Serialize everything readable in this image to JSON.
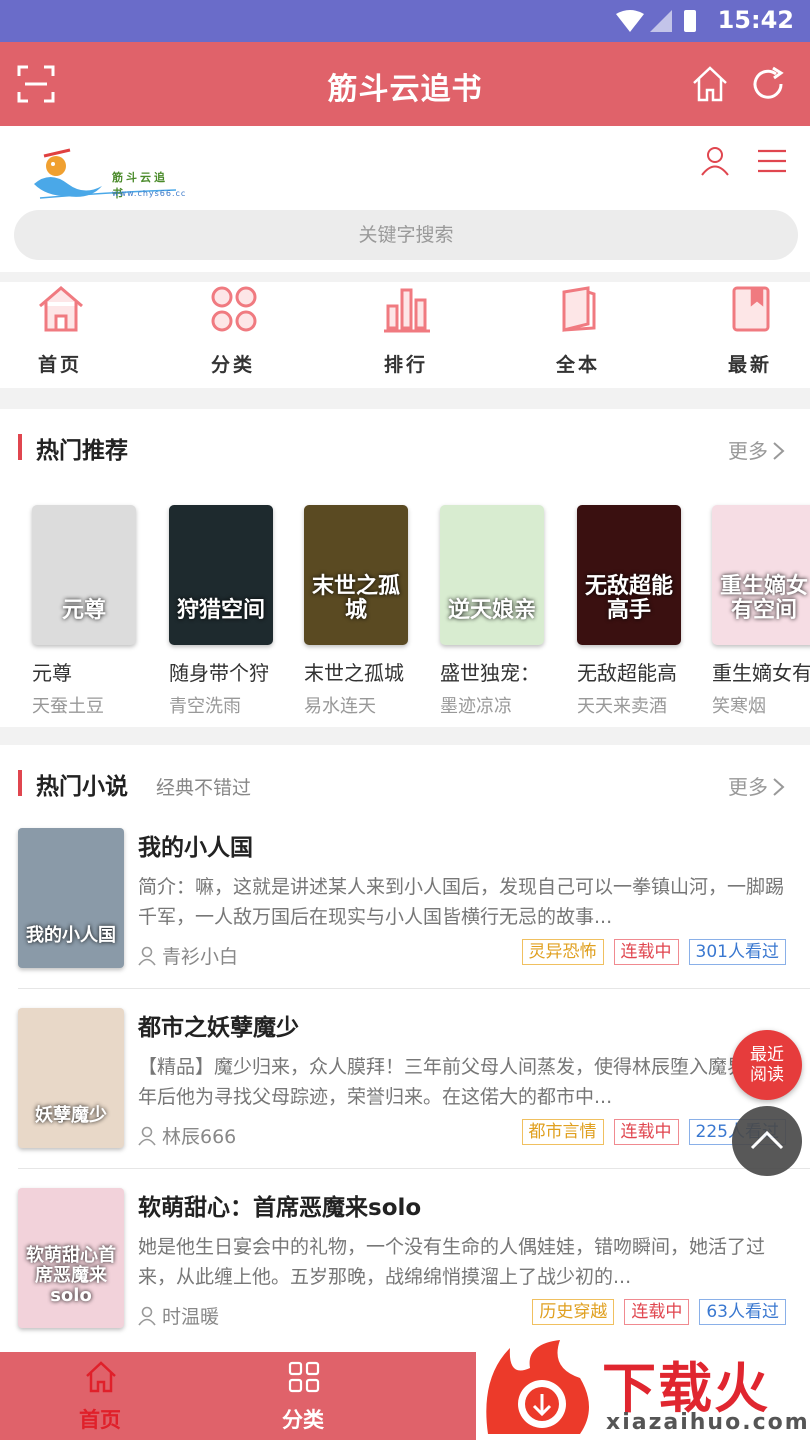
{
  "status_bar": {
    "time": "15:42"
  },
  "app_bar": {
    "title": "筋斗云追书"
  },
  "site_header": {
    "logo_text": "筋斗云追书",
    "logo_url": "www.chys66.cc",
    "search_placeholder": "关键字搜索"
  },
  "nav": [
    {
      "label": "首页",
      "icon": "home-icon"
    },
    {
      "label": "分类",
      "icon": "category-icon"
    },
    {
      "label": "排行",
      "icon": "ranking-icon"
    },
    {
      "label": "全本",
      "icon": "complete-icon"
    },
    {
      "label": "最新",
      "icon": "latest-icon"
    }
  ],
  "hot_recommend": {
    "title": "热门推荐",
    "more": "更多",
    "books": [
      {
        "title": "元尊",
        "author": "天蚕土豆",
        "cover_text": "元尊",
        "cover_color": "#dcdcdc"
      },
      {
        "title": "随身带个狩",
        "author": "青空洗雨",
        "cover_text": "狩猎空间",
        "cover_color": "#1e2a2e"
      },
      {
        "title": "末世之孤城",
        "author": "易水连天",
        "cover_text": "末世之孤城",
        "cover_color": "#5a4a22"
      },
      {
        "title": "盛世独宠：",
        "author": "墨迹凉凉",
        "cover_text": "逆天娘亲",
        "cover_color": "#d8ecd0"
      },
      {
        "title": "无敌超能高",
        "author": "天天来卖酒",
        "cover_text": "无敌超能高手",
        "cover_color": "#3a1010"
      },
      {
        "title": "重生嫡女有",
        "author": "笑寒烟",
        "cover_text": "重生嫡女有空间",
        "cover_color": "#f6dde4"
      }
    ]
  },
  "hot_novels": {
    "title": "热门小说",
    "subtitle": "经典不错过",
    "more": "更多",
    "items": [
      {
        "title": "我的小人国",
        "desc": "简介：嘛，这就是讲述某人来到小人国后，发现自己可以一拳镇山河，一脚踢千军，一人敌万国后在现实与小人国皆横行无忌的故事...",
        "author": "青衫小白",
        "category": "灵异恐怖",
        "status": "连载中",
        "views": "301人看过",
        "cover_text": "我的小人国",
        "cover_color": "#8a9aa8"
      },
      {
        "title": "都市之妖孽魔少",
        "desc": "【精品】魔少归来，众人膜拜！三年前父母人间蒸发，使得林辰堕入魔界，三年后他为寻找父母踪迹，荣誉归来。在这偌大的都市中...",
        "author": "林辰666",
        "category": "都市言情",
        "status": "连载中",
        "views": "225人看过",
        "cover_text": "妖孽魔少",
        "cover_color": "#e8d8c8"
      },
      {
        "title": "软萌甜心：首席恶魔来solo",
        "desc": "她是他生日宴会中的礼物，一个没有生命的人偶娃娃，错吻瞬间，她活了过来，从此缠上他。五岁那晚，战绵绵悄摸溜上了战少初的...",
        "author": "时温暖",
        "category": "历史穿越",
        "status": "连载中",
        "views": "63人看过",
        "cover_text": "软萌甜心首席恶魔来solo",
        "cover_color": "#f2d2da"
      }
    ]
  },
  "floating": {
    "recent_line1": "最近",
    "recent_line2": "阅读"
  },
  "tabbar": [
    {
      "label": "首页",
      "active": true
    },
    {
      "label": "分类",
      "active": false
    }
  ],
  "watermark": {
    "text": "下载火",
    "url": "xiazaihuo.com"
  },
  "colors": {
    "primary": "#e0626a",
    "status_bar": "#6a6cc9",
    "accent_red": "#e0464f"
  }
}
